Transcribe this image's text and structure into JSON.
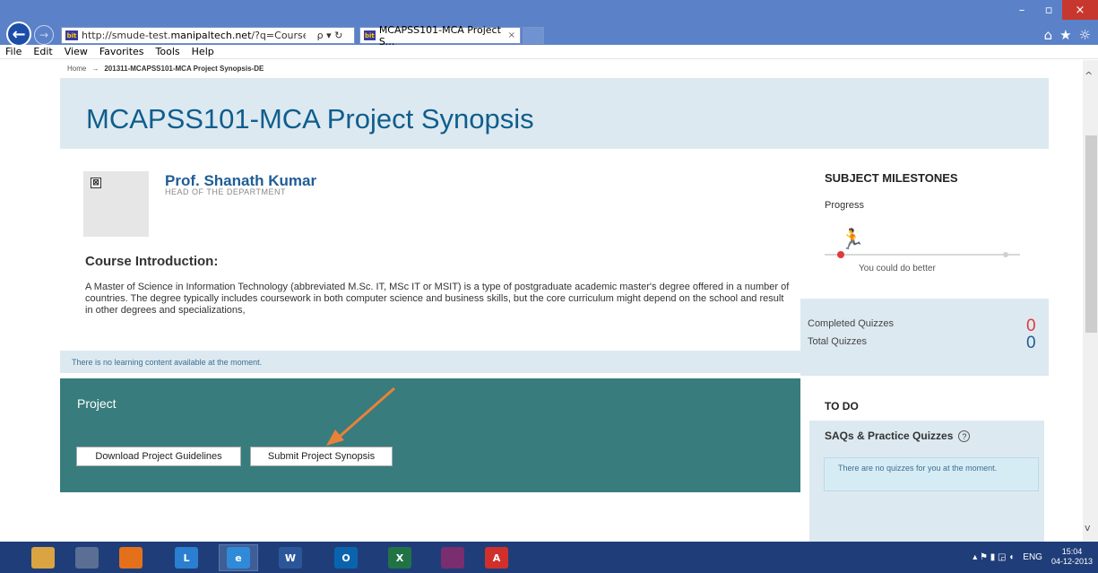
{
  "browser": {
    "url_prefix": "http://smude-test.",
    "url_domain": "manipaltech.net",
    "url_suffix": "/?q=CourseInstanc",
    "addr_controls": "ρ ▾ ↻",
    "tab_title": "MCAPSS101-MCA Project S...",
    "tab_close": "×",
    "back_glyph": "←",
    "fwd_glyph": "→",
    "win_min": "–",
    "win_max": "▫",
    "win_close": "×",
    "home_icon": "⌂",
    "fav_icon": "★",
    "settings_icon": "☼",
    "favicon_text": "bit"
  },
  "menu": [
    "File",
    "Edit",
    "View",
    "Favorites",
    "Tools",
    "Help"
  ],
  "breadcrumb": {
    "home": "Home",
    "arrow": "→",
    "current": "201311-MCAPSS101-MCA Project Synopsis-DE"
  },
  "page_title": "MCAPSS101-MCA Project Synopsis",
  "professor": {
    "name": "Prof. Shanath Kumar",
    "role": "HEAD OF THE DEPARTMENT",
    "broken_image_glyph": "⊠"
  },
  "intro": {
    "title": "Course Introduction:",
    "text": "A Master of Science in Information Technology (abbreviated M.Sc. IT, MSc IT or MSIT) is a type of postgraduate academic master's degree offered in a number of countries. The degree typically includes coursework in both computer science and business skills, but the core curriculum might depend on the school and result in other degrees and specializations,"
  },
  "notice": "There is no learning content available at the moment.",
  "project": {
    "title": "Project",
    "download_label": "Download Project Guidelines",
    "submit_label": "Submit Project Synopsis"
  },
  "milestones": {
    "title": "SUBJECT MILESTONES",
    "progress_label": "Progress",
    "progress_value": 0,
    "message": "You could do better",
    "runner_icon": "🏃"
  },
  "quizzes": {
    "completed_label": "Completed Quizzes",
    "completed_value": "0",
    "total_label": "Total Quizzes",
    "total_value": "0"
  },
  "todo": {
    "title": "TO DO",
    "saq_title": "SAQs & Practice Quizzes",
    "help_glyph": "?",
    "no_quizzes": "There are no quizzes for you at the moment."
  },
  "scroll": {
    "up": "^",
    "down": "v"
  },
  "taskbar": {
    "apps": [
      {
        "name": "file-explorer-icon",
        "label": "",
        "color": "#d9a441"
      },
      {
        "name": "tool-icon",
        "label": "",
        "color": "#5a6f93"
      },
      {
        "name": "firefox-icon",
        "label": "",
        "color": "#e5701c"
      },
      {
        "name": "lync-icon",
        "label": "L",
        "color": "#2a7fd0"
      },
      {
        "name": "internet-explorer-icon",
        "label": "e",
        "color": "#2f8ad8"
      },
      {
        "name": "word-icon",
        "label": "W",
        "color": "#2b579a"
      },
      {
        "name": "outlook-icon",
        "label": "O",
        "color": "#0a64ad"
      },
      {
        "name": "excel-icon",
        "label": "X",
        "color": "#217346"
      },
      {
        "name": "winrar-icon",
        "label": "",
        "color": "#7a2d6f"
      },
      {
        "name": "acrobat-icon",
        "label": "A",
        "color": "#d0302b"
      }
    ],
    "lang": "ENG",
    "time": "15:04",
    "date": "04-12-2013"
  },
  "colors": {
    "accent": "#0f5e8d",
    "project_panel": "#387c7d",
    "completed_value": "#e03a3a",
    "total_value": "#1f5c96"
  }
}
